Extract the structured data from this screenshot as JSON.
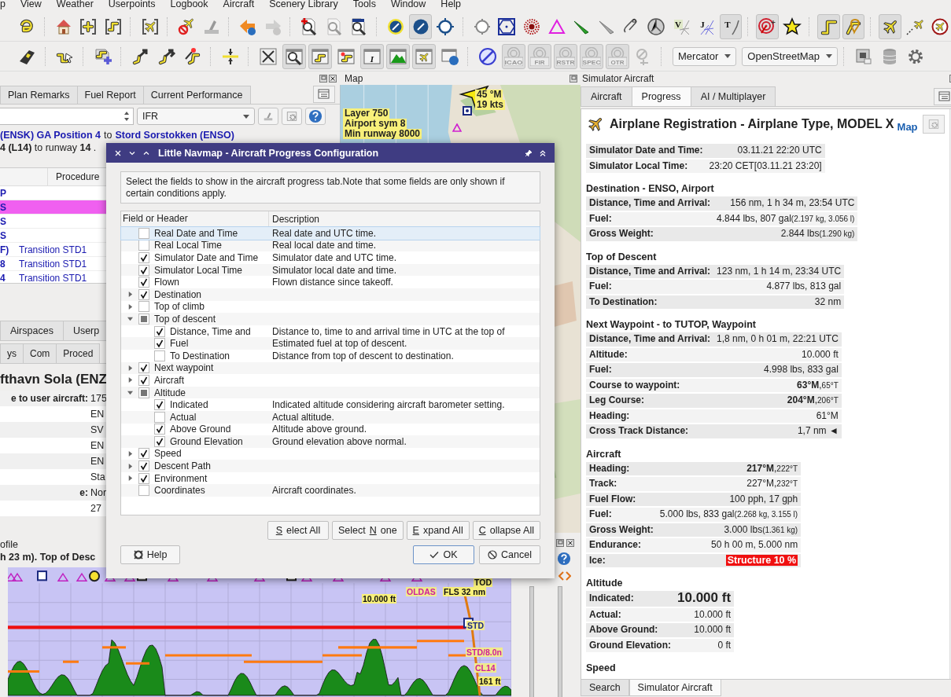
{
  "menu": [
    "p",
    "View",
    "Weather",
    "Userpoints",
    "Logbook",
    "Aircraft",
    "Scenery Library",
    "Tools",
    "Window",
    "Help"
  ],
  "toolbar_1": [
    [
      {
        "kind": "route-loop",
        "pressed": false,
        "disabled": false
      }
    ],
    [
      {
        "kind": "house",
        "pressed": false,
        "disabled": false
      },
      {
        "kind": "plus-bracket",
        "pressed": false,
        "disabled": false
      },
      {
        "kind": "route-bracket",
        "pressed": false,
        "disabled": false
      }
    ],
    [
      {
        "kind": "plane-bracket",
        "pressed": false,
        "disabled": false
      }
    ],
    [
      {
        "kind": "plane-cross",
        "pressed": false,
        "disabled": false
      },
      {
        "kind": "eraser",
        "pressed": false,
        "disabled": false
      }
    ],
    [
      {
        "kind": "arrow-left",
        "pressed": false,
        "disabled": false
      },
      {
        "kind": "arrow-right",
        "pressed": false,
        "disabled": true
      }
    ],
    [
      {
        "kind": "zoom-plus",
        "pressed": false,
        "disabled": false
      },
      {
        "kind": "zoom-page",
        "pressed": false,
        "disabled": true
      },
      {
        "kind": "zoom-box",
        "pressed": false,
        "disabled": false
      }
    ],
    [
      {
        "kind": "disc-ring",
        "pressed": false,
        "disabled": false
      },
      {
        "kind": "disc",
        "pressed": true,
        "disabled": false
      },
      {
        "kind": "ring",
        "pressed": false,
        "disabled": false
      }
    ],
    [
      {
        "kind": "ring-plain",
        "pressed": false,
        "disabled": false
      },
      {
        "kind": "hexagon",
        "pressed": false,
        "disabled": false
      },
      {
        "kind": "dots",
        "pressed": false,
        "disabled": false
      },
      {
        "kind": "triangle",
        "pressed": false,
        "disabled": false
      },
      {
        "kind": "needle",
        "pressed": false,
        "disabled": false
      },
      {
        "kind": "needle-thin",
        "pressed": false,
        "disabled": false
      },
      {
        "kind": "clip",
        "pressed": false,
        "disabled": false
      },
      {
        "kind": "compass",
        "pressed": false,
        "disabled": false
      },
      {
        "kind": "letter-lines",
        "label": "V",
        "pressed": false,
        "disabled": false
      },
      {
        "kind": "letter-cross",
        "label": "J",
        "pressed": false,
        "disabled": false
      },
      {
        "kind": "letter-curve",
        "label": "T",
        "pressed": true,
        "disabled": false
      }
    ],
    [
      {
        "kind": "target",
        "pressed": true,
        "disabled": false
      },
      {
        "kind": "star",
        "pressed": false,
        "disabled": false
      }
    ],
    [
      {
        "kind": "route",
        "pressed": true,
        "disabled": false
      },
      {
        "kind": "route-pin",
        "pressed": true,
        "disabled": false
      }
    ],
    [
      {
        "kind": "plane",
        "pressed": true,
        "disabled": false
      },
      {
        "kind": "plane-trail",
        "pressed": false,
        "disabled": false
      },
      {
        "kind": "plane-circle",
        "pressed": false,
        "disabled": false
      }
    ]
  ],
  "toolbar_2": [
    [
      {
        "kind": "tag",
        "pressed": false,
        "disabled": false
      }
    ],
    [
      {
        "kind": "route-cursor",
        "pressed": false,
        "disabled": false
      }
    ],
    [
      {
        "kind": "route-plus",
        "pressed": false,
        "disabled": false
      }
    ],
    [
      {
        "kind": "route-arrow",
        "pressed": false,
        "disabled": false
      },
      {
        "kind": "route-arrows",
        "pressed": false,
        "disabled": false
      },
      {
        "kind": "route-spark",
        "pressed": false,
        "disabled": false
      }
    ],
    [
      {
        "kind": "crosshair",
        "pressed": false,
        "disabled": false
      }
    ],
    [
      {
        "kind": "arrows-box",
        "pressed": false,
        "disabled": false
      },
      {
        "kind": "zoom-window",
        "pressed": true,
        "disabled": false
      },
      {
        "kind": "route-window",
        "pressed": true,
        "disabled": false
      },
      {
        "kind": "spark-window",
        "pressed": false,
        "disabled": false
      },
      {
        "kind": "letter-window",
        "label": "I",
        "pressed": true,
        "disabled": false
      },
      {
        "kind": "mountain-window",
        "pressed": true,
        "disabled": false
      },
      {
        "kind": "plane-window",
        "pressed": true,
        "disabled": false
      },
      {
        "kind": "help-window",
        "pressed": false,
        "disabled": false
      }
    ],
    [
      {
        "kind": "globe",
        "pressed": false,
        "disabled": false
      },
      {
        "kind": "airspace-badge",
        "label": "ICAO",
        "pressed": true,
        "disabled": true
      },
      {
        "kind": "airspace-badge",
        "label": "FIR",
        "pressed": true,
        "disabled": true
      },
      {
        "kind": "airspace-badge",
        "label": "RSTR",
        "pressed": true,
        "disabled": true
      },
      {
        "kind": "airspace-badge",
        "label": "SPEC",
        "pressed": true,
        "disabled": true
      },
      {
        "kind": "airspace-badge",
        "label": "OTR",
        "pressed": true,
        "disabled": true
      },
      {
        "kind": "airspace-tool",
        "pressed": false,
        "disabled": true
      }
    ],
    [
      {
        "kind": "combo",
        "value": "Mercator"
      },
      {
        "kind": "combo",
        "value": "OpenStreetMap"
      }
    ],
    [
      {
        "kind": "map-window",
        "pressed": false,
        "disabled": false
      },
      {
        "kind": "database",
        "pressed": false,
        "disabled": false
      },
      {
        "kind": "gear",
        "pressed": false,
        "disabled": false
      }
    ]
  ],
  "flightplan": {
    "tabs": [
      {
        "label": "Plan Remarks",
        "selected": false
      },
      {
        "label": "Fuel Report",
        "selected": false
      },
      {
        "label": "Current Performance",
        "selected": false
      }
    ],
    "flight_type": "IFR",
    "route_from": "(ENSK) GA Position 4",
    "route_to_word": "to",
    "route_to": "Stord Sorstokken (ENSO)",
    "route_detail": "**4 (L14)** to runway **14** .",
    "procedure_header": "Procedure",
    "legs": [
      {
        "ident": "P",
        "active": false
      },
      {
        "ident": "S",
        "active": true
      },
      {
        "ident": "S",
        "active": false
      },
      {
        "ident": "S",
        "active": false
      },
      {
        "ident": "F)",
        "procedure": "Transition STD1",
        "active": false
      },
      {
        "ident": "8",
        "procedure": "Transition STD1",
        "active": false
      },
      {
        "ident": "4",
        "procedure": "Transition STD1",
        "active": false
      }
    ]
  },
  "info": {
    "tabs": [
      {
        "label": "Airspaces",
        "selected": false
      },
      {
        "label": "Userp",
        "selected": false
      }
    ],
    "subtabs": [
      {
        "label": "ys",
        "selected": false
      },
      {
        "label": "Com",
        "selected": false
      },
      {
        "label": "Proced",
        "selected": false
      }
    ],
    "title": "fthavn Sola (ENZ",
    "rows": [
      {
        "label": "e to user aircraft:",
        "value": "175"
      },
      {
        "value": "EN"
      },
      {
        "value": "SV"
      },
      {
        "value": "EN"
      },
      {
        "value": "EN"
      },
      {
        "value": "Sta"
      },
      {
        "label": "e:",
        "value": "Nor"
      },
      {
        "value": "27"
      }
    ]
  },
  "map": {
    "title": "Map",
    "heading": "45 °M",
    "speed": "19 kts",
    "legend": [
      "Layer 750",
      "Airport sym 8",
      "Min runway 8000"
    ]
  },
  "profile": {
    "title": "ofile",
    "summary": "h 23 m). Top of Desc",
    "labels": [
      {
        "text": "10.000 ft",
        "kind": "altitude"
      },
      {
        "text": "OLDAS",
        "kind": "waypoint"
      },
      {
        "text": "FLS 32 nm",
        "kind": "altitude"
      },
      {
        "text": "TOD",
        "kind": "altitude"
      },
      {
        "text": "STD",
        "kind": "navaid"
      },
      {
        "text": "STD/8.0n",
        "kind": "waypoint"
      },
      {
        "text": "CL14",
        "kind": "waypoint"
      },
      {
        "text": "161 ft",
        "kind": "altitude"
      }
    ]
  },
  "dialog": {
    "title": "Little Navmap - Aircraft Progress Configuration",
    "intro": "Select the fields to show in the aircraft progress tab.Note that some fields are only shown if certain conditions apply.",
    "columns": [
      "Field or Header",
      "Description"
    ],
    "fields": [
      {
        "label": "Real Date and Time",
        "description": "Real date and UTC time.",
        "checked": false,
        "selected": true
      },
      {
        "label": "Real Local Time",
        "description": "Real local date and time.",
        "checked": false,
        "selected": false
      },
      {
        "label": "Simulator Date and Time",
        "description": "Simulator date and UTC time.",
        "checked": true,
        "selected": false
      },
      {
        "label": "Simulator Local Time",
        "description": "Simulator local date and time.",
        "checked": true,
        "selected": false
      },
      {
        "label": "Flown",
        "description": "Flown distance since takeoff.",
        "checked": true,
        "selected": false
      },
      {
        "label": "Destination",
        "checked": true,
        "selected": false,
        "expanded": false
      },
      {
        "label": "Top of climb",
        "checked": false,
        "selected": false,
        "expanded": false
      },
      {
        "label": "Top of descent",
        "partial": true,
        "selected": false,
        "expanded": true,
        "children": [
          {
            "label": "Distance, Time and",
            "description": "Distance to, time to and arrival time in UTC at the top of",
            "checked": true,
            "selected": false
          },
          {
            "label": "Fuel",
            "description": "Estimated fuel at top of descent.",
            "checked": true,
            "selected": false
          },
          {
            "label": "To Destination",
            "description": "Distance from top of descent to destination.",
            "checked": false,
            "selected": false
          }
        ]
      },
      {
        "label": "Next waypoint",
        "checked": true,
        "selected": false,
        "expanded": false
      },
      {
        "label": "Aircraft",
        "checked": true,
        "selected": false,
        "expanded": false
      },
      {
        "label": "Altitude",
        "partial": true,
        "selected": false,
        "expanded": true,
        "children": [
          {
            "label": "Indicated",
            "description": "Indicated altitude considering aircraft barometer setting.",
            "checked": true,
            "selected": false
          },
          {
            "label": "Actual",
            "description": "Actual altitude.",
            "checked": false,
            "selected": false
          },
          {
            "label": "Above Ground",
            "description": "Altitude above ground.",
            "checked": true,
            "selected": false
          },
          {
            "label": "Ground Elevation",
            "description": "Ground elevation above normal.",
            "checked": true,
            "selected": false
          }
        ]
      },
      {
        "label": "Speed",
        "checked": true,
        "selected": false,
        "expanded": false
      },
      {
        "label": "Descent Path",
        "checked": true,
        "selected": false,
        "expanded": false
      },
      {
        "label": "Environment",
        "checked": true,
        "selected": false,
        "expanded": false
      },
      {
        "label": "Coordinates",
        "description": "Aircraft coordinates.",
        "checked": false,
        "selected": false
      }
    ],
    "tree_buttons": [
      {
        "key": "S",
        "post": "elect All"
      },
      {
        "pre": "Select ",
        "key": "N",
        "post": "one"
      },
      {
        "key": "E",
        "post": "xpand All"
      },
      {
        "key": "C",
        "post": "ollapse All"
      }
    ],
    "help": "Help",
    "ok": "OK",
    "cancel": "Cancel"
  },
  "aircraft_panel": {
    "title": "Simulator Aircraft",
    "tabs": [
      {
        "label": "Aircraft",
        "selected": false
      },
      {
        "label": "Progress",
        "selected": true
      },
      {
        "label": "AI / Multiplayer",
        "selected": false
      }
    ],
    "heading": "Airplane Registration - Airplane Type, MODEL X",
    "map_link": "Map",
    "sections": [
      {
        "rows": [
          {
            "label": "Simulator Date and Time:",
            "value": "03.11.21 22:20 UTC"
          },
          {
            "label": "Simulator Local Time:",
            "value": "23:20 CET[03.11.21 23:20]"
          }
        ]
      },
      {
        "heading": "Destination - ENSO, Airport",
        "rows": [
          {
            "label": "Distance, Time and Arrival:",
            "value": "156 nm, 1 h 34 m, 23:54 UTC"
          },
          {
            "label": "Fuel:",
            "value": "4.844 lbs, 807 gal",
            "small": "(2.197 kg, 3.056 l)"
          },
          {
            "label": "Gross Weight:",
            "value": "2.844 lbs",
            "small": "(1.290 kg)"
          }
        ]
      },
      {
        "heading": "Top of Descent",
        "rows": [
          {
            "label": "Distance, Time and Arrival:",
            "value": "123 nm, 1 h 14 m, 23:34 UTC"
          },
          {
            "label": "Fuel:",
            "value": "4.877 lbs, 813 gal"
          },
          {
            "label": "To Destination:",
            "value": "32 nm"
          }
        ]
      },
      {
        "heading": "Next Waypoint - to TUTOP, Waypoint",
        "rows": [
          {
            "label": "Distance, Time and Arrival:",
            "value": "1,8 nm, 0 h 01 m, 22:21 UTC"
          },
          {
            "label": "Altitude:",
            "value": "10.000 ft"
          },
          {
            "label": "Fuel:",
            "value": "4.998 lbs, 833 gal"
          },
          {
            "label": "Course to waypoint:",
            "value": "**63°M**,",
            "small": "65°T"
          },
          {
            "label": "Leg Course:",
            "value": "**204°M**,",
            "small": "206°T"
          },
          {
            "label": "Heading:",
            "value": "61°M"
          },
          {
            "label": "Cross Track Distance:",
            "value": "1,7 nm ◄"
          }
        ]
      },
      {
        "heading": "Aircraft",
        "rows": [
          {
            "label": "Heading:",
            "value": "**217°M**,",
            "small": "222°T"
          },
          {
            "label": "Track:",
            "value": "227°M,",
            "small": "232°T"
          },
          {
            "label": "Fuel Flow:",
            "value": "100 pph, 17 gph"
          },
          {
            "label": "Fuel:",
            "value": "5.000 lbs, 833 gal",
            "small": "(2.268 kg, 3.155 l)"
          },
          {
            "label": "Gross Weight:",
            "value": "3.000 lbs",
            "small": "(1.361 kg)"
          },
          {
            "label": "Endurance:",
            "value": "50 h 00 m, 5.000 nm"
          },
          {
            "label": "Ice:",
            "value": "Structure 10 %",
            "kind": "alert"
          }
        ]
      },
      {
        "heading": "Altitude",
        "rows": [
          {
            "label": "Indicated:",
            "value": "10.000 ft",
            "kind": "large"
          },
          {
            "label": "Actual:",
            "value": "10.000 ft"
          },
          {
            "label": "Above Ground:",
            "value": "10.000 ft"
          },
          {
            "label": "Ground Elevation:",
            "value": "0 ft"
          }
        ]
      },
      {
        "heading": "Speed"
      }
    ],
    "bottom_tabs": [
      {
        "label": "Search",
        "selected": false
      },
      {
        "label": "Simulator Aircraft",
        "selected": true
      }
    ]
  }
}
